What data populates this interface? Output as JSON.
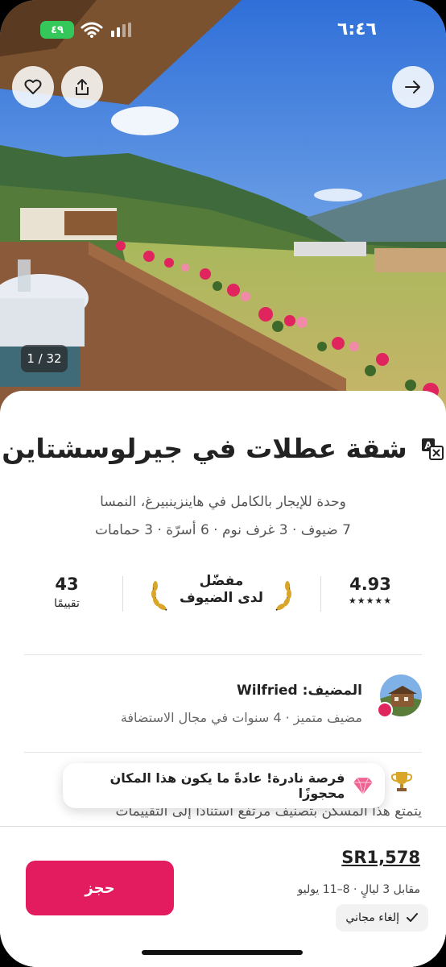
{
  "status_bar": {
    "time": "٦:٤٦",
    "battery": "٤٩"
  },
  "photo": {
    "counter": "1 / 32"
  },
  "listing": {
    "title": "شقة عطلات في جيرلوسشتاين",
    "subtitle": "وحدة للإيجار بالكامل في هاينزينبيرغ، النمسا",
    "details": "7 ضيوف · 3 غرف نوم · 6 أسرّة · 3 حمامات"
  },
  "stats": {
    "rating": "4.93",
    "stars": "★★★★★",
    "favorite_line1": "مفضّل",
    "favorite_line2": "لدى الضيوف",
    "reviews_count": "43",
    "reviews_label": "تقييمًا"
  },
  "host": {
    "name": "المضيف: Wilfried",
    "info": "مضيف متميز · 4 سنوات في مجال الاستضافة"
  },
  "rare_find": "فرصة نادرة! عادةً ما يكون هذا المكان محجوزًا",
  "description_preview": "يتمتع هذا المسكن بتصنيف مرتفع استنادًا إلى التقييمات",
  "booking": {
    "price": "SR1,578",
    "dates": "مقابل 3 ليالٍ · 8–11 يوليو",
    "free_cancellation": "إلغاء مجاني",
    "book_label": "حجز"
  },
  "colors": {
    "brand": "#e31c5f",
    "battery": "#34c759"
  }
}
